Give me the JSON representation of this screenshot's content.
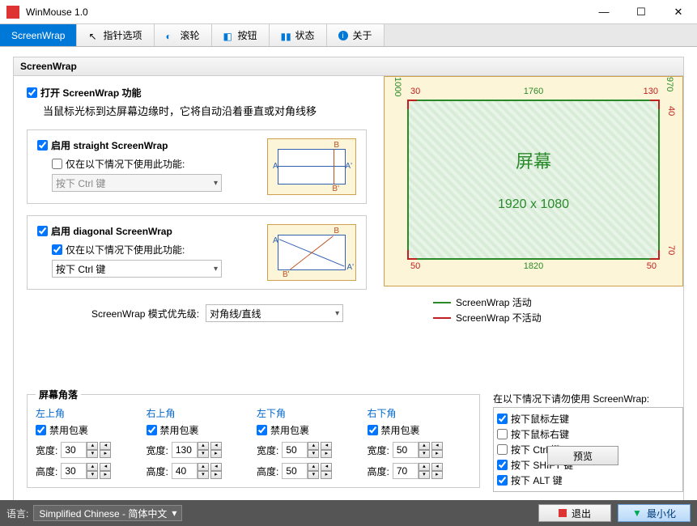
{
  "window": {
    "title": "WinMouse 1.0",
    "min": "—",
    "max": "☐",
    "close": "✕"
  },
  "tabs": {
    "screenwrap": "ScreenWrap",
    "pointer": "指针选项",
    "wheel": "滚轮",
    "buttons": "按钮",
    "status": "状态",
    "about": "关于"
  },
  "panel": {
    "heading": "ScreenWrap",
    "enable": "打开 ScreenWrap 功能",
    "desc": "当鼠标光标到达屏幕边缘时，它将自动沿着垂直或对角线移",
    "straight": {
      "enable": "启用 straight ScreenWrap",
      "only": "仅在以下情况下使用此功能:",
      "combo": "按下 Ctrl 键"
    },
    "diagonal": {
      "enable": "启用 diagonal ScreenWrap",
      "only": "仅在以下情况下使用此功能:",
      "combo": "按下 Ctrl 键"
    },
    "priority_label": "ScreenWrap 模式优先级:",
    "priority_value": "对角线/直线",
    "screen": {
      "caption": "屏幕",
      "res": "1920 x 1080",
      "top": "1760",
      "bottom": "1820",
      "left": "1000",
      "right": "970",
      "tl": "30",
      "tr": "130",
      "trr": "40",
      "bl": "50",
      "br": "50",
      "brr": "70",
      "legend_active": "ScreenWrap 活动",
      "legend_inactive": "ScreenWrap 不活动"
    },
    "exclude": {
      "label": "在以下情况下请勿使用 ScreenWrap:",
      "items": [
        {
          "label": "按下鼠标左键",
          "checked": true
        },
        {
          "label": "按下鼠标右键",
          "checked": false
        },
        {
          "label": "按下 Ctrl 键",
          "checked": false
        },
        {
          "label": "按下 SHIFT 键",
          "checked": true
        },
        {
          "label": "按下 ALT 键",
          "checked": true
        }
      ]
    },
    "preview": "预览",
    "corners": {
      "legend": "屏幕角落",
      "width": "宽度:",
      "height": "高度:",
      "disable": "禁用包裹",
      "cols": [
        {
          "h": "左上角",
          "w": "30",
          "ht": "30"
        },
        {
          "h": "右上角",
          "w": "130",
          "ht": "40"
        },
        {
          "h": "左下角",
          "w": "50",
          "ht": "50"
        },
        {
          "h": "右下角",
          "w": "50",
          "ht": "70"
        }
      ]
    }
  },
  "footer": {
    "lang_label": "语言:",
    "lang_value": "Simplified Chinese  -  简体中文",
    "exit": "退出",
    "min": "最小化"
  }
}
